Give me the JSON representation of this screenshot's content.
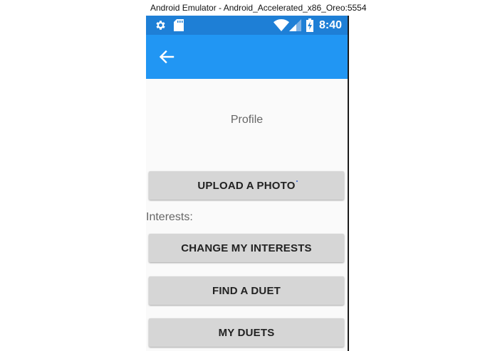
{
  "window": {
    "title": "Android Emulator - Android_Accelerated_x86_Oreo:5554"
  },
  "status_bar": {
    "time": "8:40",
    "icons": [
      "gear-icon",
      "sd-card-icon",
      "wifi-icon",
      "cell-signal-icon",
      "battery-charging-icon"
    ]
  },
  "app_bar": {
    "back_icon": "arrow-left-icon"
  },
  "profile": {
    "title": "Profile",
    "upload_button": "UPLOAD A PHOTO",
    "interests_label": "Interests:",
    "change_interests_button": "CHANGE MY INTERESTS",
    "find_duet_button": "FIND A DUET",
    "my_duets_button": "MY DUETS"
  },
  "colors": {
    "status_bar": "#1e7fd6",
    "app_bar": "#2196f3",
    "button_bg": "#d6d6d6",
    "background": "#fafafa"
  }
}
